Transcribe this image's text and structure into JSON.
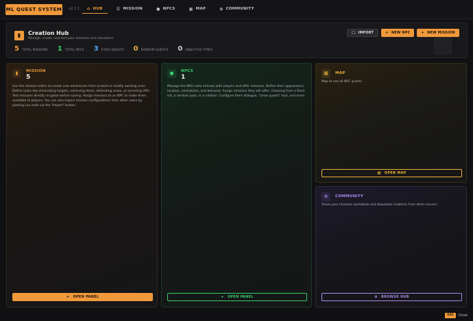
{
  "app": {
    "logo": "ML QUEST SYSTEM",
    "version": "v2.1.3"
  },
  "nav": [
    {
      "label": "HUB",
      "icon": "home-icon",
      "glyph": "⌂",
      "active": true
    },
    {
      "label": "MISSION",
      "icon": "list-icon",
      "glyph": "☰",
      "active": false
    },
    {
      "label": "NPCS",
      "icon": "person-icon",
      "glyph": "👤",
      "active": false
    },
    {
      "label": "MAP",
      "icon": "map-icon",
      "glyph": "▦",
      "active": false
    },
    {
      "label": "COMMUNITY",
      "icon": "globe-icon",
      "glyph": "⊕",
      "active": false
    }
  ],
  "hero": {
    "title": "Creation Hub",
    "subtitle": "Manage, create, and test your missions and characters.",
    "stats": [
      {
        "value": "5",
        "label": "TOTAL MISSIONS",
        "color": "#f0993b"
      },
      {
        "value": "1",
        "label": "TOTAL NPCS",
        "color": "#3ccf6e"
      },
      {
        "value": "3",
        "label": "FIXED QUESTS",
        "color": "#5aa9f0"
      },
      {
        "value": "0",
        "label": "RANDOM QUESTS",
        "color": "#f0b43b"
      },
      {
        "value": "0",
        "label": "OBJECTIVE TYPES",
        "color": "#c8c8cc"
      }
    ],
    "actions": {
      "import": "IMPORT",
      "new_npc": "NEW NPC",
      "new_mission": "NEW MISSION"
    }
  },
  "panels": {
    "mission": {
      "label": "MISSION",
      "count": "5",
      "description": "Use the mission editor to create new adventures from scratch or modify existing ones. Define tasks like eliminating targets, retrieving items, defending areas, or escorting VIPs. Test missions directly in-game before saving. Assign missions to an NPC to make them available to players. You can also import mission configurations from other users by pasting Lua code via the \"Import\" button.",
      "button": "OPEN PANEL",
      "accent": "#f0993b"
    },
    "npcs": {
      "label": "NPCS",
      "count": "1",
      "description": "Manage the NPCs who interact with players and offer missions. Define their appearance, location, animations, and behavior. Assign missions they will offer, choosing from a fixed list, a random pool, or a rotation. Configure their dialogue, \"show quests\" text, and more.",
      "button": "OPEN PANEL",
      "accent": "#3ccf6e"
    },
    "map": {
      "label": "MAP",
      "description": "Map to see all NPC quests.",
      "button": "OPEN MAP",
      "accent": "#f0b43b"
    },
    "community": {
      "label": "COMMUNITY",
      "description": "Share your missions worldwide and download creations from other servers.",
      "button": "BROWSE HUB",
      "accent": "#a98cf0"
    }
  },
  "footer": {
    "esc": "ESC",
    "close": "Close"
  }
}
